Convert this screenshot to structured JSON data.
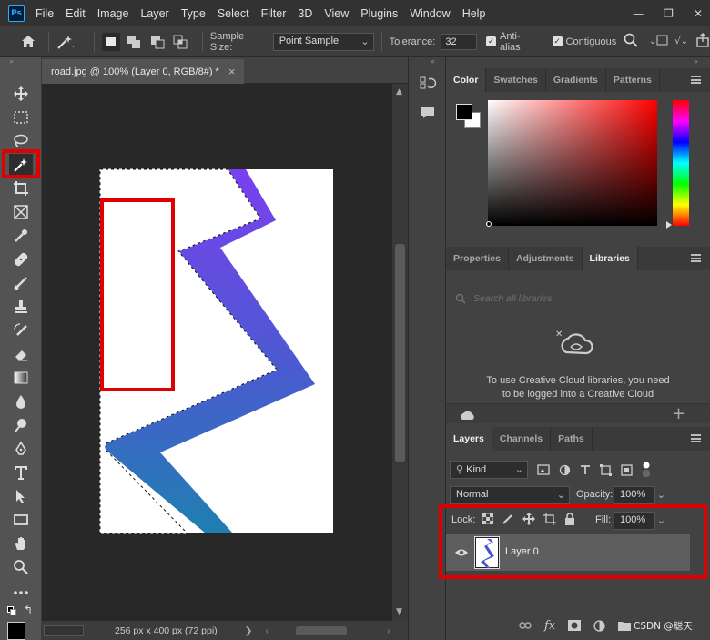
{
  "app": {
    "logo": "Ps"
  },
  "menu": [
    "File",
    "Edit",
    "Image",
    "Layer",
    "Type",
    "Select",
    "Filter",
    "3D",
    "View",
    "Plugins",
    "Window",
    "Help"
  ],
  "window_controls": {
    "minimize": "—",
    "restore": "❐",
    "close": "✕"
  },
  "options": {
    "sample_size_label": "Sample Size:",
    "sample_size_value": "Point Sample",
    "tolerance_label": "Tolerance:",
    "tolerance_value": "32",
    "anti_alias_label": "Anti-alias",
    "contiguous_label": "Contiguous"
  },
  "document": {
    "tab_title": "road.jpg @ 100% (Layer 0, RGB/8#) *",
    "tab_close": "×",
    "status": "256 px x 400 px (72 ppi)",
    "status_arrow": "❯"
  },
  "color_panel": {
    "tabs": [
      "Color",
      "Swatches",
      "Gradients",
      "Patterns"
    ],
    "active_tab": "Color",
    "foreground": "#000000",
    "background": "#ffffff",
    "hue": "#ff0000"
  },
  "libraries_panel": {
    "tabs": [
      "Properties",
      "Adjustments",
      "Libraries"
    ],
    "active_tab": "Libraries",
    "search_placeholder": "Search all libraries",
    "message_line1": "To use Creative Cloud libraries, you need",
    "message_line2": "to be logged into a Creative Cloud",
    "add": "+"
  },
  "layers_panel": {
    "tabs": [
      "Layers",
      "Channels",
      "Paths"
    ],
    "active_tab": "Layers",
    "filter_kind": "Kind",
    "blend_mode": "Normal",
    "opacity_label": "Opacity:",
    "opacity_value": "100%",
    "lock_label": "Lock:",
    "fill_label": "Fill:",
    "fill_value": "100%",
    "layers": [
      {
        "name": "Layer 0",
        "visible": true
      }
    ]
  },
  "watermark": "CSDN @聪天",
  "colors": {
    "highlight": "#e10000",
    "road_top": "#7a3ff0",
    "road_bottom": "#1f7fb0"
  }
}
